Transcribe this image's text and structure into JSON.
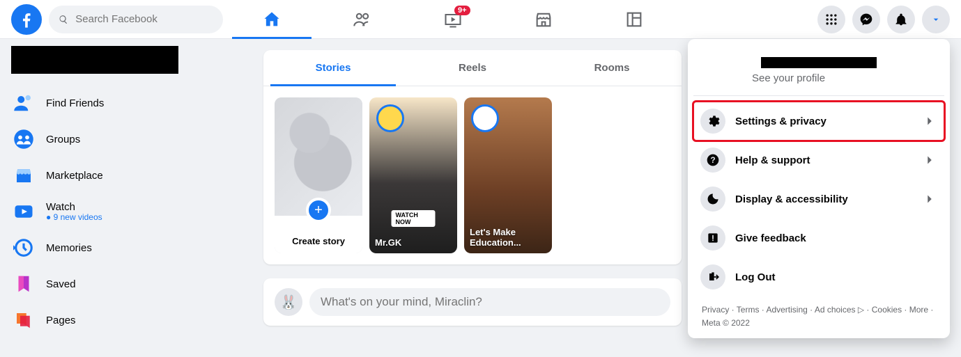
{
  "header": {
    "search_placeholder": "Search Facebook",
    "live_badge": "9+"
  },
  "sidebar": {
    "items": [
      {
        "label": "Find Friends",
        "sub": ""
      },
      {
        "label": "Groups",
        "sub": ""
      },
      {
        "label": "Marketplace",
        "sub": ""
      },
      {
        "label": "Watch",
        "sub": "9 new videos"
      },
      {
        "label": "Memories",
        "sub": ""
      },
      {
        "label": "Saved",
        "sub": ""
      },
      {
        "label": "Pages",
        "sub": ""
      }
    ]
  },
  "stories": {
    "tabs": {
      "stories": "Stories",
      "reels": "Reels",
      "rooms": "Rooms"
    },
    "create_label": "Create story",
    "cards": [
      {
        "name": "Mr.GK",
        "tag": "WATCH NOW"
      },
      {
        "name": "Let's Make Education..."
      }
    ]
  },
  "composer": {
    "placeholder": "What's on your mind, Miraclin?"
  },
  "menu": {
    "profile_sub": "See your profile",
    "items": [
      {
        "label": "Settings & privacy",
        "icon": "gear",
        "chev": true
      },
      {
        "label": "Help & support",
        "icon": "help",
        "chev": true
      },
      {
        "label": "Display & accessibility",
        "icon": "moon",
        "chev": true
      },
      {
        "label": "Give feedback",
        "icon": "feedback",
        "chev": false
      },
      {
        "label": "Log Out",
        "icon": "logout",
        "chev": false
      }
    ],
    "footer": "Privacy · Terms · Advertising · Ad choices ▷ · Cookies · More · Meta © 2022"
  }
}
